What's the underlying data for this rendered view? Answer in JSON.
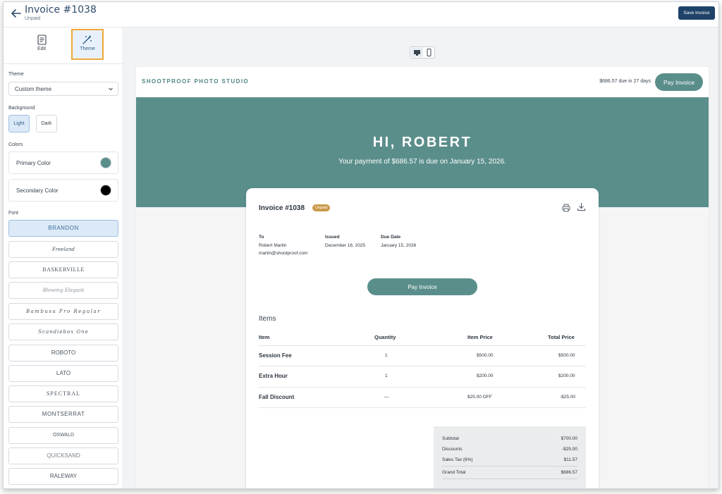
{
  "header": {
    "title": "Invoice #1038",
    "status": "Unpaid",
    "save_label": "Save Invoice"
  },
  "left_panel": {
    "tabs": [
      {
        "label": "Edit",
        "icon": "document-icon"
      },
      {
        "label": "Theme",
        "icon": "magic-wand-icon",
        "active": true
      }
    ],
    "theme_label": "Theme",
    "theme_value": "Custom theme",
    "background_label": "Background",
    "background_options": [
      "Light",
      "Dark"
    ],
    "background_selected": "Light",
    "colors_label": "Colors",
    "primary_color_label": "Primary Color",
    "primary_color": "#5a8e8b",
    "secondary_color_label": "Secondary Color",
    "secondary_color": "#000000",
    "font_label": "Font",
    "fonts": [
      "BRANDON",
      "Freeland",
      "BASKERVILLE",
      "Blowing Elegant",
      "Bambusa Pro Regular",
      "Scandiebox One",
      "ROBOTO",
      "LATO",
      "SPECTRAL",
      "MONTSERRAT",
      "OSWALD",
      "QUICKSAND",
      "RALEWAY"
    ],
    "font_selected": "BRANDON"
  },
  "preview": {
    "studio_name": "SHOOTPROOF PHOTO STUDIO",
    "due_text": "$686.57 due in 27 days",
    "pay_label": "Pay Invoice",
    "greeting": "HI, ROBERT",
    "hero_subtitle": "Your payment of $686.57 is due on January 15, 2026.",
    "accent": "#5a8e8b",
    "invoice": {
      "title": "Invoice #1038",
      "badge": "Unpaid",
      "to_label": "To",
      "to_name": "Robert Martin",
      "to_email": "martin@shootproof.com",
      "issued_label": "Issued",
      "issued_value": "December 16, 2025",
      "due_label": "Due Date",
      "due_value": "January 15, 2026",
      "pay_label": "Pay Invoice",
      "items_heading": "Items",
      "columns": [
        "Item",
        "Quantity",
        "Item Price",
        "Total Price"
      ],
      "rows": [
        {
          "item": "Session Fee",
          "qty": "1",
          "price": "$500.00",
          "total": "$500.00"
        },
        {
          "item": "Extra Hour",
          "qty": "1",
          "price": "$200.00",
          "total": "$200.00"
        },
        {
          "item": "Fall Discount",
          "qty": "—",
          "price": "$25.00 OFF",
          "total": "-$25.00"
        }
      ],
      "totals": [
        {
          "label": "Subtotal",
          "value": "$700.00"
        },
        {
          "label": "Discounts",
          "value": "-$25.00"
        },
        {
          "label": "Sales Tax (6%)",
          "value": "$11.57"
        },
        {
          "label": "Grand Total",
          "value": "$686.57"
        }
      ]
    }
  }
}
